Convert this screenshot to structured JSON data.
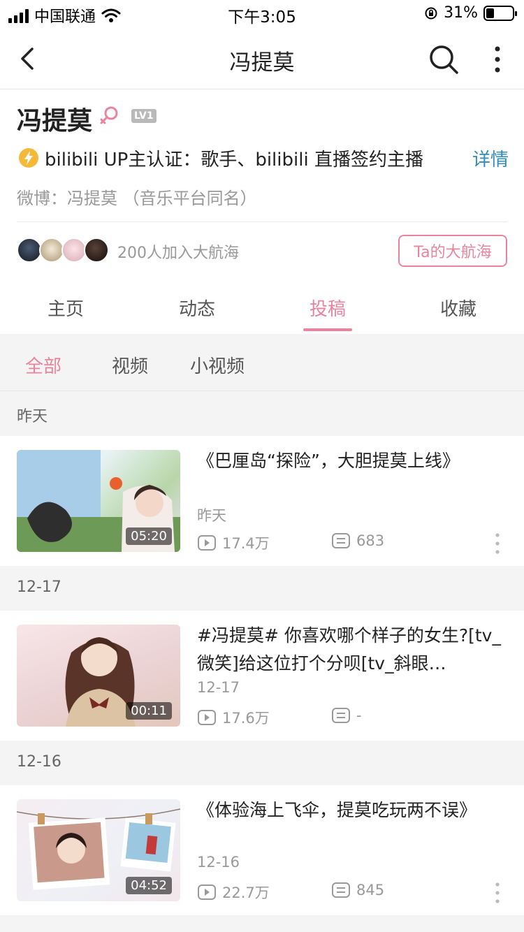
{
  "status_bar": {
    "carrier": "中国联通",
    "time": "下午3:05",
    "battery_text": "31%",
    "battery_level": 0.31
  },
  "nav": {
    "title": "冯提莫",
    "icons": [
      "chevron-left-icon",
      "search-icon",
      "more-vertical-icon"
    ]
  },
  "profile": {
    "name": "冯提莫",
    "gender": "female",
    "level": "LV1",
    "verify_text": "bilibili  UP主认证：歌手、bilibili  直播签约主播",
    "verify_detail": "详情",
    "weibo": "微博：冯提莫  （音乐平台同名）",
    "fan_count_text": "200人加入大航海",
    "fleet_button": "Ta的大航海"
  },
  "main_tabs": [
    {
      "label": "主页",
      "active": false
    },
    {
      "label": "动态",
      "active": false
    },
    {
      "label": "投稿",
      "active": true
    },
    {
      "label": "收藏",
      "active": false
    }
  ],
  "filters": [
    {
      "label": "全部",
      "active": true
    },
    {
      "label": "视频",
      "active": false
    },
    {
      "label": "小视频",
      "active": false
    }
  ],
  "sections": [
    {
      "date": "昨天",
      "video": {
        "title": "《巴厘岛“探险”，大胆提莫上线》",
        "date": "昨天",
        "duration": "05:20",
        "views": "17.4万",
        "comments": "683"
      }
    },
    {
      "date": "12-17",
      "video": {
        "title": "#冯提莫#  你喜欢哪个样子的女生?[tv_微笑]给这位打个分呗[tv_斜眼…",
        "date": "12-17",
        "duration": "00:11",
        "views": "17.6万",
        "comments": "-"
      }
    },
    {
      "date": "12-16",
      "video": {
        "title": "《体验海上飞伞，提莫吃玩两不误》",
        "date": "12-16",
        "duration": "04:52",
        "views": "22.7万",
        "comments": "845"
      }
    }
  ],
  "colors": {
    "accent": "#e8849d",
    "link": "#2f8db8",
    "muted": "#999999"
  }
}
